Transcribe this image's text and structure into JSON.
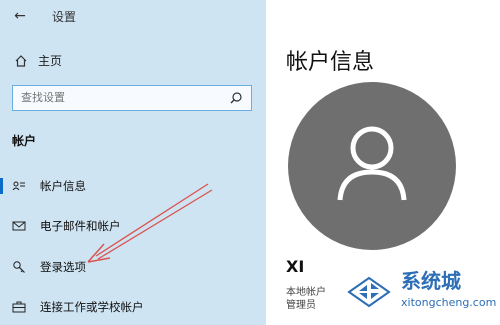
{
  "app": {
    "title": "设置",
    "back_icon": "back-arrow-icon"
  },
  "sidebar": {
    "home_label": "主页",
    "search_placeholder": "查找设置",
    "section_title": "帐户",
    "items": [
      {
        "label": "帐户信息",
        "icon": "user-card-icon",
        "active": true
      },
      {
        "label": "电子邮件和帐户",
        "icon": "mail-icon",
        "active": false
      },
      {
        "label": "登录选项",
        "icon": "key-icon",
        "active": false
      },
      {
        "label": "连接工作或学校帐户",
        "icon": "briefcase-icon",
        "active": false
      }
    ]
  },
  "main": {
    "title": "帐户信息",
    "user_name": "XI",
    "account_type": "本地帐户",
    "role": "管理员",
    "avatar_icon": "person-icon"
  },
  "watermark": {
    "title": "系统城",
    "url": "xitongcheng.com"
  },
  "colors": {
    "sidebar_bg": "#cfe4f3",
    "avatar_bg": "#6f6f6f",
    "accent": "#0a6cc9",
    "annotation_arrow": "#d9534f",
    "watermark_blue": "#2d6eb6"
  }
}
